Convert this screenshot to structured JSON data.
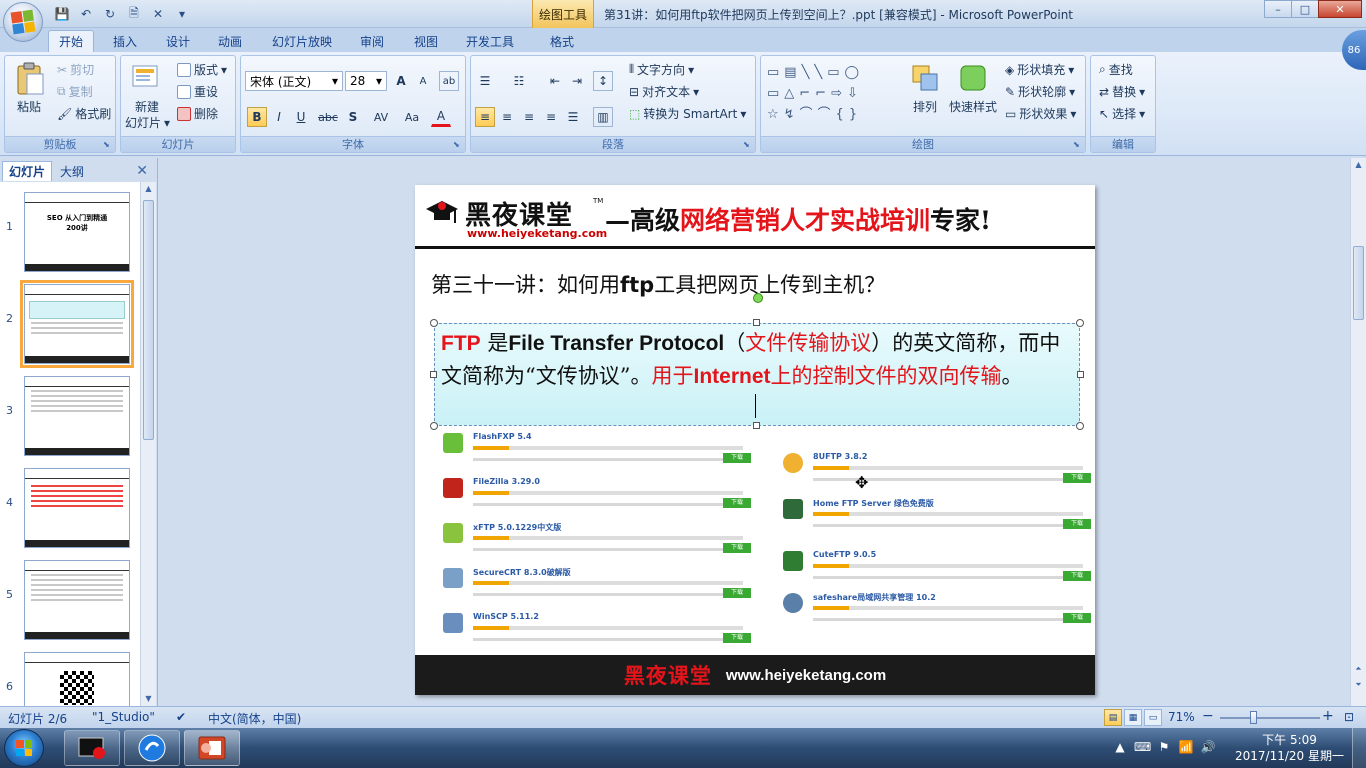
{
  "titlebar": {
    "context_tab": "绘图工具",
    "title": "第31讲：如何用ftp软件把网页上传到空间上？.ppt [兼容模式] - Microsoft PowerPoint",
    "minimize": "–",
    "maximize": "□",
    "close": "✕"
  },
  "qat": {
    "save": "💾",
    "undo": "↶",
    "redo": "↻",
    "print": "🗎",
    "extra": "✕",
    "more": "▾"
  },
  "tabs": [
    "开始",
    "插入",
    "设计",
    "动画",
    "幻灯片放映",
    "审阅",
    "视图",
    "开发工具",
    "格式"
  ],
  "help": "86",
  "ribbon": {
    "clipboard": {
      "label": "剪贴板",
      "paste": "粘贴",
      "cut": "剪切",
      "copy": "复制",
      "format_painter": "格式刷"
    },
    "slides": {
      "label": "幻灯片",
      "new_slide_1": "新建",
      "new_slide_2": "幻灯片",
      "layout": "版式",
      "reset": "重设",
      "delete": "删除"
    },
    "font": {
      "label": "字体",
      "font_name": "宋体 (正文)",
      "font_size": "28",
      "grow": "A",
      "shrink": "A",
      "clear": "ab",
      "bold": "B",
      "italic": "I",
      "underline": "U",
      "strike": "abc",
      "shadow": "S",
      "spacing": "AV",
      "case": "Aa",
      "color": "A"
    },
    "paragraph": {
      "label": "段落",
      "text_direction": "文字方向",
      "align_text": "对齐文本",
      "smartart": "转换为 SmartArt"
    },
    "drawing": {
      "label": "绘图",
      "arrange": "排列",
      "quick_styles": "快速样式",
      "shape_fill": "形状填充",
      "shape_outline": "形状轮廓",
      "shape_effects": "形状效果"
    },
    "editing": {
      "label": "编辑",
      "find": "查找",
      "replace": "替换",
      "select": "选择"
    }
  },
  "left_pane": {
    "tab_slides": "幻灯片",
    "tab_outline": "大纲",
    "close": "✕",
    "slide_numbers": [
      "1",
      "2",
      "3",
      "4",
      "5",
      "6"
    ],
    "thumb1_title": "SEO 从入门到精通",
    "thumb1_sub": "200讲"
  },
  "slide": {
    "brand": "黑夜课堂",
    "tm": "TM",
    "url": "www.heiyeketang.com",
    "slogan_dash": "—高级",
    "slogan_red": "网络营销人才实战培训",
    "slogan_end": "专家!",
    "title_pre": "第三十一讲：如何用",
    "title_bold": "ftp",
    "title_post": "工具把网页上传到主机？",
    "body_ftp": "FTP",
    "body_is": " 是",
    "body_fullname": "File Transfer Protocol",
    "body_paren_open": "（",
    "body_cn_name": "文件传输协议",
    "body_paren_close": "）",
    "body_rest": "的英文简称，而中文简称为“文传协议”。",
    "body_red_1": "用于",
    "body_red_internet": "Internet",
    "body_red_2": "上的控制文件的双向传输",
    "body_end": "。",
    "software_left": [
      "FlashFXP 5.4",
      "FileZilla 3.29.0",
      "xFTP 5.0.1229中文版",
      "SecureCRT 8.3.0破解版",
      "WinSCP 5.11.2"
    ],
    "software_right": [
      "8UFTP 3.8.2",
      "Home FTP Server 绿色免费版",
      "CuteFTP 9.0.5",
      "safeshare局域网共享管理 10.2"
    ],
    "download": "下载",
    "footer_brand": "黑夜课堂",
    "footer_url": "www.heiyeketang.com"
  },
  "statusbar": {
    "slide_pos": "幻灯片 2/6",
    "theme": "\"1_Studio\"",
    "language": "中文(简体，中国)",
    "zoom": "71%",
    "zoom_out": "−",
    "zoom_in": "+"
  },
  "taskbar": {
    "time": "下午 5:09",
    "date": "2017/11/20 星期一"
  }
}
